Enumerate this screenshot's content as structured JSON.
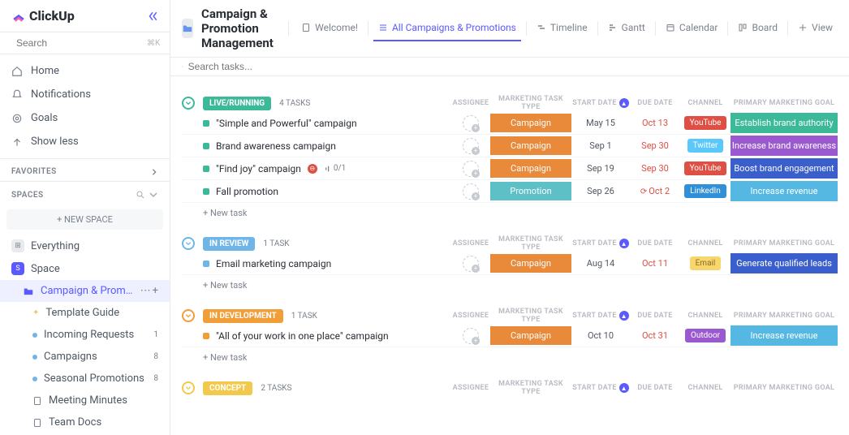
{
  "app": {
    "name": "ClickUp"
  },
  "sidebar": {
    "search_placeholder": "Search",
    "search_shortcut": "⌘K",
    "nav": [
      {
        "icon": "home",
        "label": "Home"
      },
      {
        "icon": "bell",
        "label": "Notifications"
      },
      {
        "icon": "target",
        "label": "Goals"
      },
      {
        "icon": "arrow-up",
        "label": "Show less"
      }
    ],
    "favorites_label": "FAVORITES",
    "spaces_label": "SPACES",
    "new_space_label": "+  NEW SPACE",
    "everything_label": "Everything",
    "space": {
      "name": "Space",
      "color": "#5a5aff",
      "initial": "S",
      "list": {
        "name": "Campaign & Promotion M…"
      },
      "children": [
        {
          "icon": "doc",
          "label": "Template Guide",
          "bullet": "#f5c26b"
        },
        {
          "icon": "dot",
          "label": "Incoming Requests",
          "badge": "1"
        },
        {
          "icon": "dot",
          "label": "Campaigns",
          "badge": "8"
        },
        {
          "icon": "dot",
          "label": "Seasonal Promotions",
          "badge": "8"
        },
        {
          "icon": "doc-gray",
          "label": "Meeting Minutes"
        },
        {
          "icon": "doc-gray",
          "label": "Team Docs"
        }
      ]
    }
  },
  "header": {
    "folder_title": "Campaign & Promotion Management",
    "tabs": [
      {
        "icon": "doc",
        "label": "Welcome!"
      },
      {
        "icon": "list",
        "label": "All Campaigns & Promotions",
        "active": true
      },
      {
        "icon": "timeline",
        "label": "Timeline"
      },
      {
        "icon": "gantt",
        "label": "Gantt"
      },
      {
        "icon": "calendar",
        "label": "Calendar"
      },
      {
        "icon": "board",
        "label": "Board"
      },
      {
        "icon": "plus",
        "label": "View"
      }
    ],
    "search_placeholder": "Search tasks..."
  },
  "columns": {
    "assignee": "ASSIGNEE",
    "task_type": "MARKETING TASK TYPE",
    "start": "START DATE",
    "due": "DUE DATE",
    "channel": "CHANNEL",
    "goal": "PRIMARY MARKETING GOAL"
  },
  "groups": [
    {
      "status": "LIVE/RUNNING",
      "color": "#3bb999",
      "count_label": "4 TASKS",
      "tasks": [
        {
          "name": "\"Simple and Powerful\" campaign",
          "task_type": "Campaign",
          "type_color": "#e88a3a",
          "start": "May 15",
          "due": "Oct 13",
          "due_red": true,
          "channel": "YouTube",
          "channel_color": "#e04f44",
          "goal": "Establish brand authority",
          "goal_color": "#3bb999"
        },
        {
          "name": "Brand awareness campaign",
          "task_type": "Campaign",
          "type_color": "#e88a3a",
          "start": "Sep 1",
          "due": "Sep 30",
          "due_red": true,
          "channel": "Twitter",
          "channel_color": "#5ac8fa",
          "goal": "Increase brand awareness",
          "goal_color": "#9b59d0"
        },
        {
          "name": "\"Find joy\" campaign",
          "blocked": true,
          "subtasks": "0/1",
          "task_type": "Campaign",
          "type_color": "#e88a3a",
          "start": "Sep 19",
          "due": "Sep 30",
          "due_red": true,
          "channel": "YouTube",
          "channel_color": "#e04f44",
          "goal": "Boost brand engagement",
          "goal_color": "#3a5fcd"
        },
        {
          "name": "Fall promotion",
          "task_type": "Promotion",
          "type_color": "#5dc0c7",
          "start": "Sep 26",
          "due": "Oct 2",
          "due_red": true,
          "recurring": true,
          "channel": "LinkedIn",
          "channel_color": "#2f8fd8",
          "goal": "Increase revenue",
          "goal_color": "#55b8e2"
        }
      ]
    },
    {
      "status": "IN REVIEW",
      "color": "#6fb6e8",
      "count_label": "1 TASK",
      "tasks": [
        {
          "name": "Email marketing campaign",
          "task_type": "Campaign",
          "type_color": "#e88a3a",
          "start": "Aug 14",
          "due": "Oct 11",
          "due_red": true,
          "channel": "Email",
          "channel_color": "#f8d66d",
          "channel_text": "#8a6d1f",
          "goal": "Generate qualified leads",
          "goal_color": "#3a5fcd"
        }
      ]
    },
    {
      "status": "IN DEVELOPMENT",
      "color": "#f29e38",
      "count_label": "1 TASK",
      "tasks": [
        {
          "name": "\"All of your work in one place\" campaign",
          "task_type": "Campaign",
          "type_color": "#e88a3a",
          "start": "Oct 10",
          "due": "Oct 31",
          "due_red": true,
          "channel": "Outdoor",
          "channel_color": "#9b59d0",
          "goal": "Increase revenue",
          "goal_color": "#55b8e2"
        }
      ]
    },
    {
      "status": "CONCEPT",
      "color": "#f2c94c",
      "count_label": "2 TASKS",
      "tasks": []
    }
  ],
  "new_task_label": "+ New task"
}
